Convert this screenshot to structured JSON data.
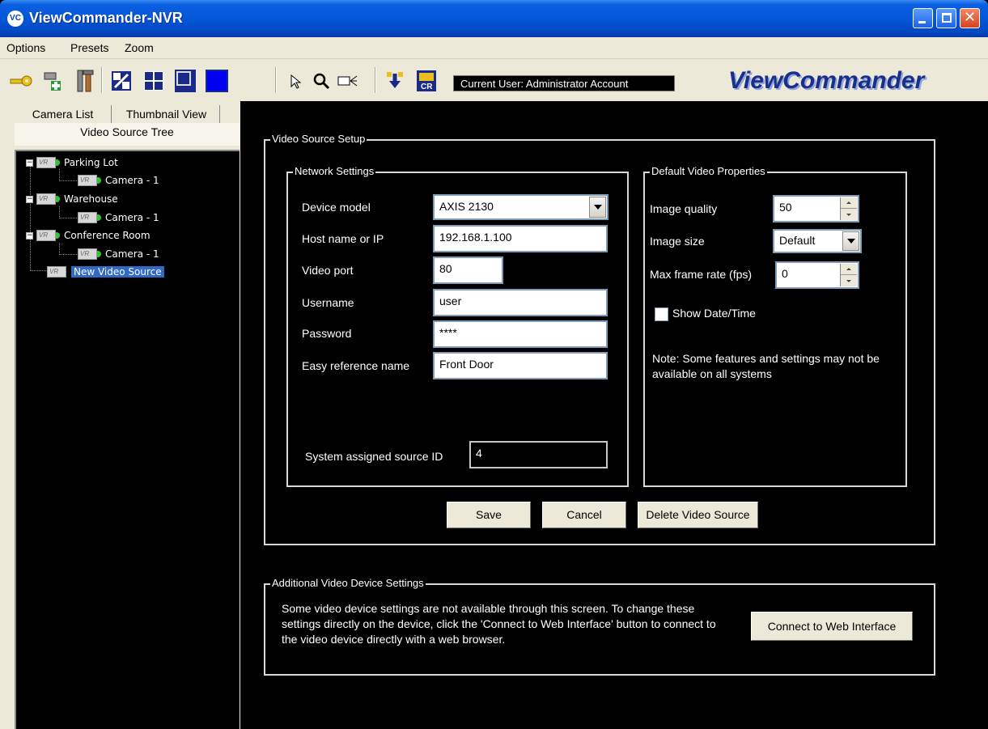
{
  "window": {
    "title": "ViewCommander-NVR",
    "icon_text": "VC"
  },
  "menu": [
    "Options",
    "Presets",
    "Zoom"
  ],
  "toolbar": {
    "icons": [
      "key-icon",
      "add-camera-icon",
      "tools-icon",
      "edit-layout-icon",
      "grid-4-icon",
      "layout-frame-icon",
      "layout-full-icon",
      "pointer-icon",
      "zoom-icon",
      "camera-control-icon",
      "download-icon",
      "car-lookup-icon"
    ],
    "current_user": "Current User: Administrator Account",
    "brand": "ViewCommander"
  },
  "left_tabs": {
    "camera_list": "Camera List",
    "thumbnail_view": "Thumbnail View",
    "video_source_tree": "Video Source Tree"
  },
  "tree": [
    {
      "label": "Parking Lot",
      "children": [
        "Camera - 1"
      ]
    },
    {
      "label": "Warehouse",
      "children": [
        "Camera - 1"
      ]
    },
    {
      "label": "Conference Room",
      "children": [
        "Camera - 1"
      ]
    },
    {
      "label": "New Video Source",
      "children": [],
      "selected": true
    }
  ],
  "video_source_setup": {
    "title": "Video Source Setup",
    "network": {
      "title": "Network Settings",
      "device_model_label": "Device model",
      "device_model_value": "AXIS 2130",
      "host_label": "Host name or IP",
      "host_value": "192.168.1.100",
      "port_label": "Video port",
      "port_value": "80",
      "username_label": "Username",
      "username_value": "user",
      "password_label": "Password",
      "password_value": "****",
      "easyref_label": "Easy reference name",
      "easyref_value": "Front Door",
      "source_id_label": "System assigned source ID",
      "source_id_value": "4"
    },
    "video_props": {
      "title": "Default Video Properties",
      "quality_label": "Image quality",
      "quality_value": "50",
      "size_label": "Image size",
      "size_value": "Default",
      "fps_label": "Max frame rate (fps)",
      "fps_value": "0",
      "show_date_label": "Show Date/Time",
      "note": "Note: Some features and settings may not be available on all systems"
    },
    "buttons": {
      "save": "Save",
      "cancel": "Cancel",
      "delete": "Delete Video Source"
    }
  },
  "additional": {
    "title": "Additional Video Device Settings",
    "text": "Some video device settings are not available through this screen. To change these settings directly on the device, click the 'Connect to Web Interface' button to connect to the video device directly with a web browser.",
    "connect_button": "Connect to Web Interface"
  }
}
